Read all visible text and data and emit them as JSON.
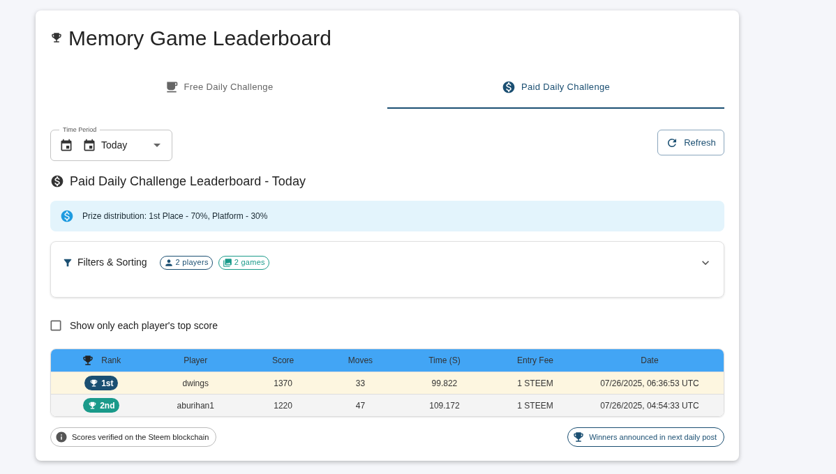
{
  "title": "Memory Game Leaderboard",
  "tabs": [
    {
      "label": "Free Daily Challenge",
      "kind": "free",
      "selected": false
    },
    {
      "label": "Paid Daily Challenge",
      "kind": "paid",
      "selected": true
    }
  ],
  "time_period": {
    "label": "Time Period",
    "value": "Today"
  },
  "refresh_button": "Refresh",
  "section_title": "Paid Daily Challenge Leaderboard - Today",
  "alert": "Prize distribution: 1st Place - 70%, Platform - 30%",
  "filters": {
    "label": "Filters & Sorting",
    "expanded": false,
    "chips": [
      {
        "label": "2 players",
        "kind": "players",
        "color": "#1b4f72"
      },
      {
        "label": "2 games",
        "kind": "games",
        "color": "#1a9a8a"
      }
    ]
  },
  "top_score_checkbox": {
    "label": "Show only each player's top score",
    "checked": false
  },
  "table": {
    "columns": [
      "Rank",
      "Player",
      "Score",
      "Moves",
      "Time (S)",
      "Entry Fee",
      "Date"
    ],
    "rows": [
      {
        "color": "#1b4f72",
        "cells": [
          "1st",
          "dwings",
          "1370",
          "33",
          "99.822",
          "1 STEEM",
          "07/26/2025, 06:36:53 UTC"
        ]
      },
      {
        "color": "#1a9a8a",
        "cells": [
          "2nd",
          "aburihan1",
          "1220",
          "47",
          "109.172",
          "1 STEEM",
          "07/26/2025, 04:54:33 UTC"
        ]
      }
    ]
  },
  "footer": {
    "verified": "Scores verified on the Steem blockchain",
    "winners": "Winners announced in next daily post"
  }
}
